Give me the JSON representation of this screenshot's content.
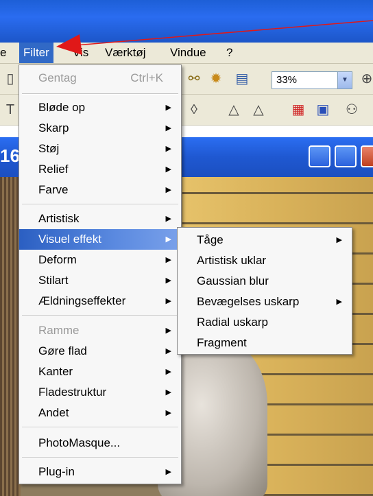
{
  "menubar": {
    "items": [
      {
        "label": "e"
      },
      {
        "label": "Filter"
      },
      {
        "label": "Vis"
      },
      {
        "label": "Værktøj"
      },
      {
        "label": "Vindue"
      },
      {
        "label": "?"
      }
    ]
  },
  "toolbar": {
    "zoom_value": "33%"
  },
  "document": {
    "title_fragment": "16"
  },
  "filter_menu": {
    "repeat": {
      "label": "Gentag",
      "shortcut": "Ctrl+K"
    },
    "group1": [
      "Bløde op",
      "Skarp",
      "Støj",
      "Relief",
      "Farve"
    ],
    "group2": [
      "Artistisk",
      "Visuel effekt",
      "Deform",
      "Stilart",
      "Ældningseffekter"
    ],
    "group3": [
      "Ramme",
      "Gøre flad",
      "Kanter",
      "Fladestruktur",
      "Andet"
    ],
    "photomasque": "PhotoMasque...",
    "plugin": "Plug-in"
  },
  "visual_effect_submenu": {
    "items": [
      "Tåge",
      "Artistisk uklar",
      "Gaussian blur",
      "Bevægelses uskarp",
      "Radial uskarp",
      "Fragment"
    ]
  },
  "colors": {
    "highlight": "#2b5fc2",
    "annotation": "#e01818",
    "titlebar": "#2a6cf0"
  }
}
